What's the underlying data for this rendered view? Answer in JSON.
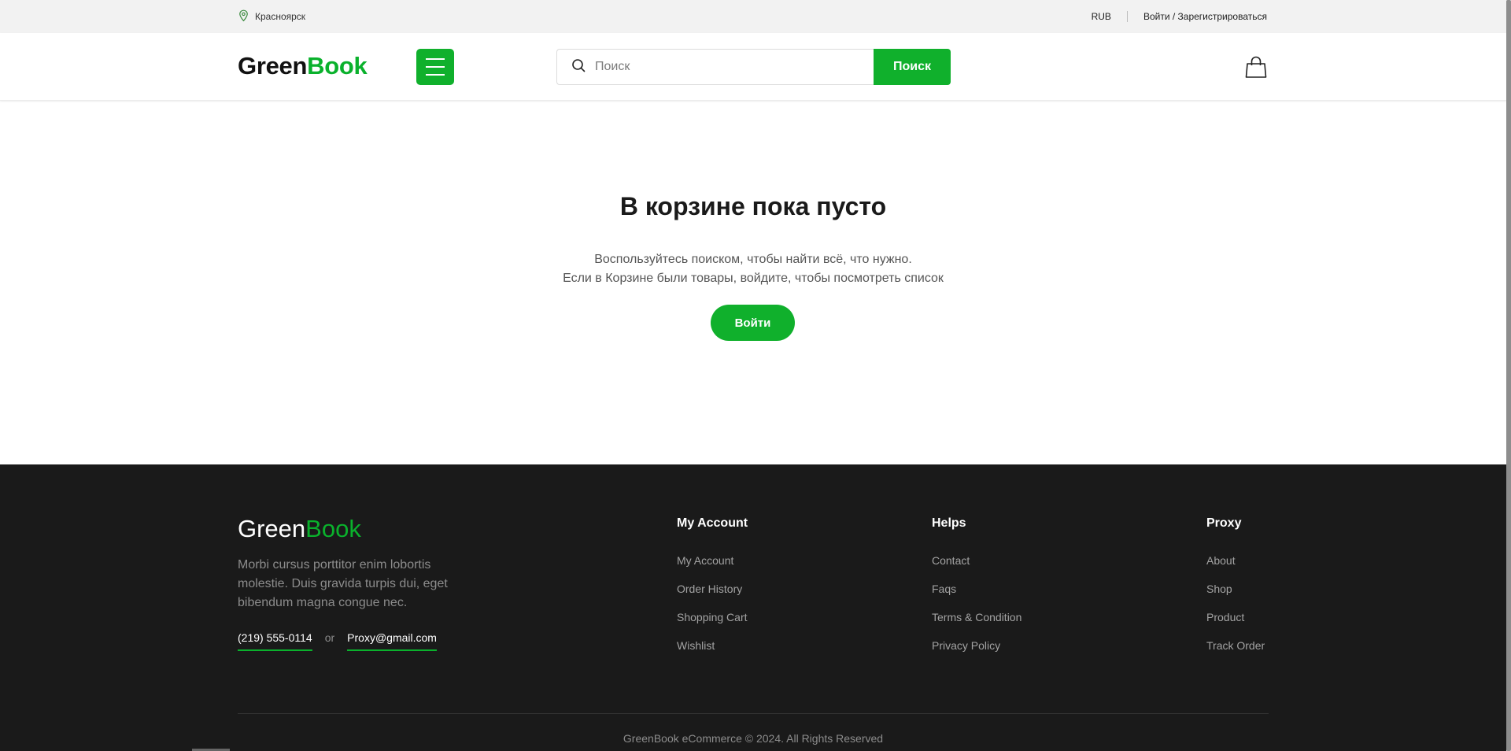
{
  "colors": {
    "brand_green": "#10b02c",
    "footer_bg": "#1a1a1a",
    "topbar_bg": "#f2f2f2"
  },
  "topbar": {
    "location_icon": "map-pin-icon",
    "location": "Красноярск",
    "currency": "RUB",
    "auth_link": "Войти / Зарегистрироваться"
  },
  "header": {
    "logo_part1": "Green",
    "logo_part2": "Book",
    "menu_icon": "hamburger-icon",
    "search_icon": "search-icon",
    "search_placeholder": "Поиск",
    "search_button": "Поиск",
    "cart_icon": "shopping-bag-icon"
  },
  "main": {
    "title": "В корзине пока пусто",
    "line1": "Воспользуйтесь поиском, чтобы найти всё, что нужно.",
    "line2": "Если в Корзине были товары, войдите, чтобы посмотреть список",
    "login_button": "Войти"
  },
  "footer": {
    "logo_part1": "Green",
    "logo_part2": "Book",
    "about": "Morbi cursus porttitor enim lobortis molestie. Duis gravida turpis dui, eget bibendum magna congue nec.",
    "phone": "(219) 555-0114",
    "or": "or",
    "email": "Proxy@gmail.com",
    "columns": [
      {
        "title": "My Account",
        "items": [
          "My Account",
          "Order History",
          "Shopping Cart",
          "Wishlist"
        ]
      },
      {
        "title": "Helps",
        "items": [
          "Contact",
          "Faqs",
          "Terms & Condition",
          "Privacy Policy"
        ]
      },
      {
        "title": "Proxy",
        "items": [
          "About",
          "Shop",
          "Product",
          "Track Order"
        ]
      }
    ],
    "copyright": "GreenBook eCommerce © 2024. All Rights Reserved"
  }
}
